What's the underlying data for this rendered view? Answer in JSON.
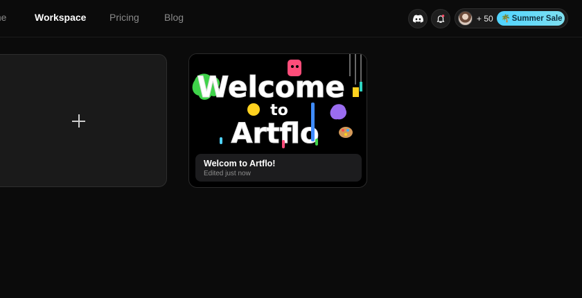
{
  "nav": {
    "items": [
      {
        "label": "me"
      },
      {
        "label": "Workspace"
      },
      {
        "label": "Pricing"
      },
      {
        "label": "Blog"
      }
    ]
  },
  "header": {
    "discord_icon": "discord-icon",
    "bell_icon": "bell-icon",
    "credits": "+ 50",
    "sale": {
      "icon": "palm-tree-icon",
      "label": "Summer Sale"
    }
  },
  "workspace": {
    "new_icon": "plus-icon",
    "project": {
      "thumbnail_text": [
        "Welcome",
        "to",
        "Artflo"
      ],
      "title": "Welcom to Artflo!",
      "edited": "Edited just now"
    }
  },
  "colors": {
    "background": "#0b0b0b",
    "accent": "#4fd3ff",
    "card": "#1a1a1a"
  }
}
